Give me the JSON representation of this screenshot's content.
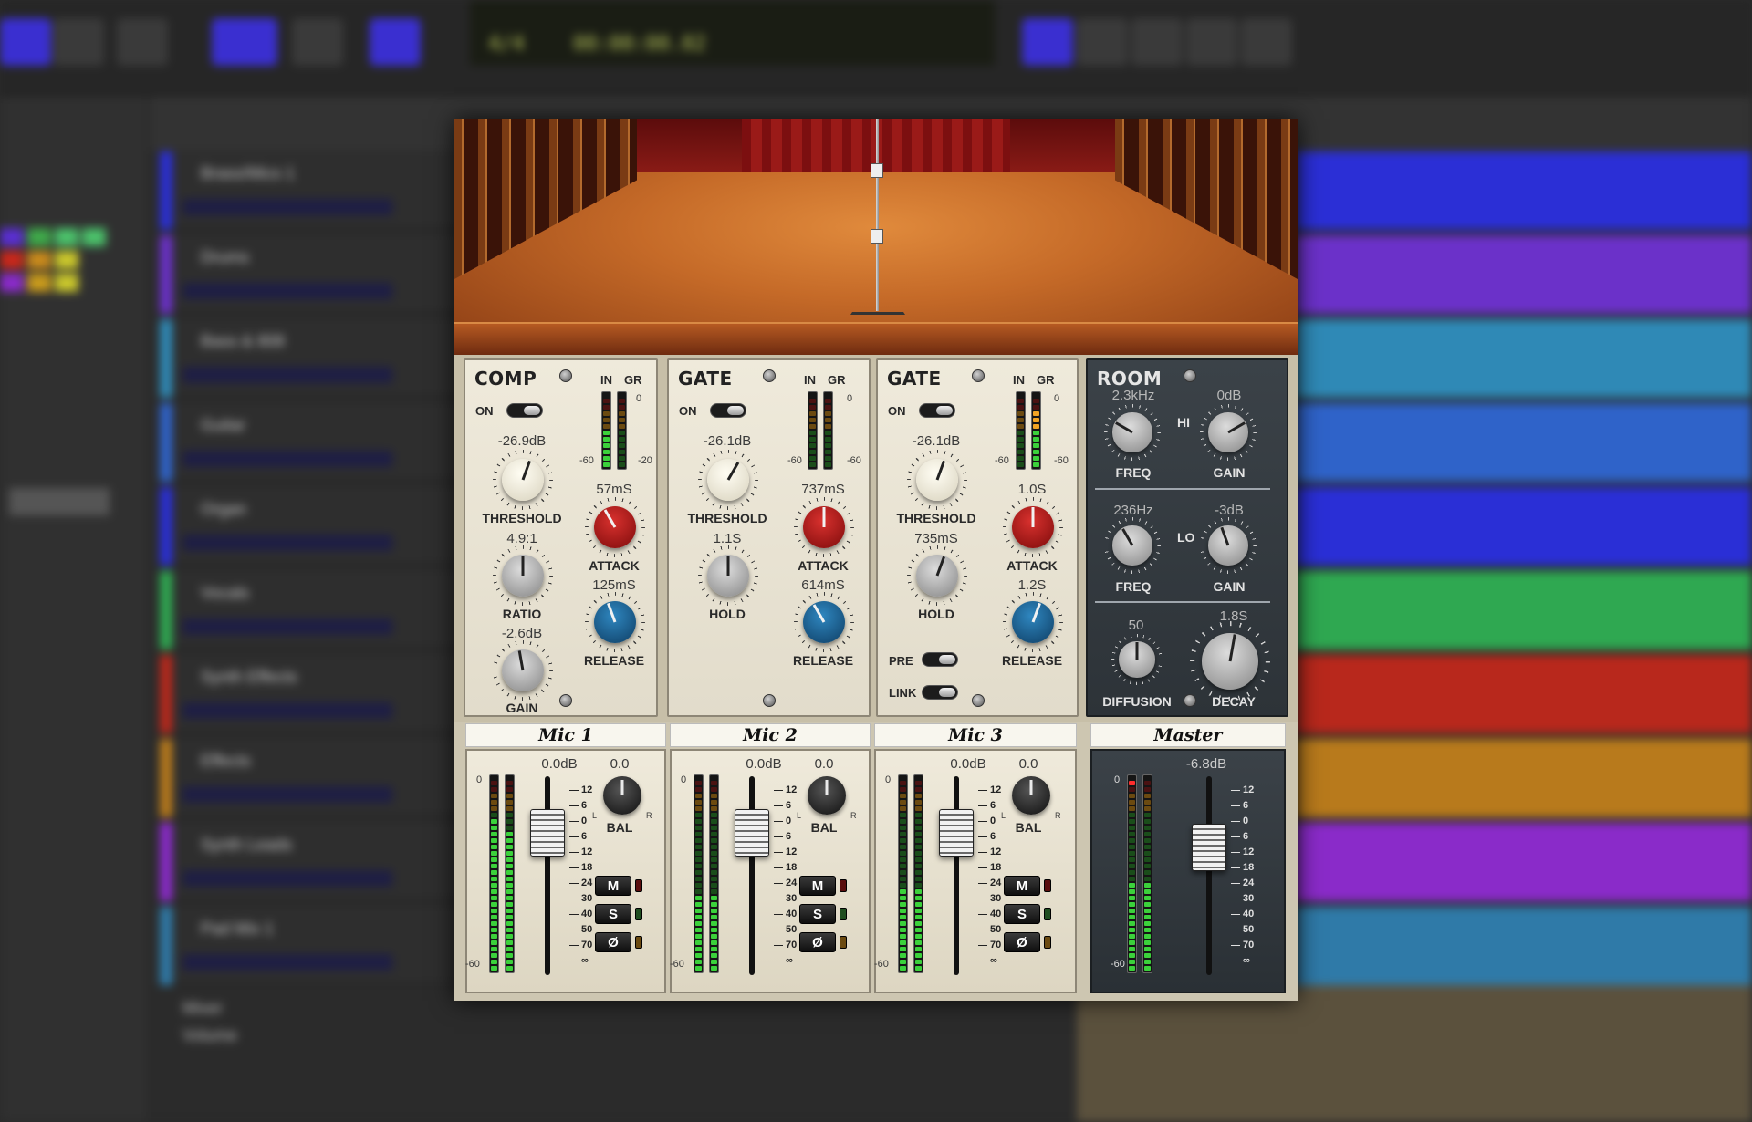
{
  "daw": {
    "lcd": [
      "4/4",
      "00:00:00.02"
    ],
    "tracks": [
      {
        "name": "Brass/Mics 1",
        "color": "#2b2fd6"
      },
      {
        "name": "Drums",
        "color": "#6b31c9"
      },
      {
        "name": "Bass & 808",
        "color": "#2f89b6"
      },
      {
        "name": "Guitar",
        "color": "#2f63c9"
      },
      {
        "name": "Organ",
        "color": "#2a2fd6"
      },
      {
        "name": "Vocals",
        "color": "#2fa851"
      },
      {
        "name": "Synth Effects",
        "color": "#b8281c"
      },
      {
        "name": "Effects",
        "color": "#b87a1c"
      },
      {
        "name": "Synth Leads",
        "color": "#8a2bc9"
      },
      {
        "name": "Pad Mix 1",
        "color": "#2f7aa8"
      }
    ],
    "bottom": {
      "label1": "Mixer",
      "label2": "Volume"
    }
  },
  "plugin": {
    "comp": {
      "title": "COMP",
      "on": "ON",
      "in": "IN",
      "gr": "GR",
      "meter_in": [
        "0",
        "-60"
      ],
      "meter_gr": [
        "0",
        "-20"
      ],
      "threshold": {
        "value": "-26.9dB",
        "label": "THRESHOLD"
      },
      "ratio": {
        "value": "4.9:1",
        "label": "RATIO"
      },
      "gain": {
        "value": "-2.6dB",
        "label": "GAIN"
      },
      "attack": {
        "value": "57mS",
        "label": "ATTACK"
      },
      "release": {
        "value": "125mS",
        "label": "RELEASE"
      }
    },
    "gate1": {
      "title": "GATE",
      "on": "ON",
      "in": "IN",
      "gr": "GR",
      "meter_in": [
        "0",
        "-60"
      ],
      "meter_gr": [
        "0",
        "-60"
      ],
      "threshold": {
        "value": "-26.1dB",
        "label": "THRESHOLD"
      },
      "hold": {
        "value": "1.1S",
        "label": "HOLD"
      },
      "attack": {
        "value": "737mS",
        "label": "ATTACK"
      },
      "release": {
        "value": "614mS",
        "label": "RELEASE"
      }
    },
    "gate2": {
      "title": "GATE",
      "on": "ON",
      "in": "IN",
      "gr": "GR",
      "meter_in": [
        "0",
        "-60"
      ],
      "meter_gr": [
        "0",
        "-60"
      ],
      "threshold": {
        "value": "-26.1dB",
        "label": "THRESHOLD"
      },
      "hold": {
        "value": "735mS",
        "label": "HOLD"
      },
      "attack": {
        "value": "1.0S",
        "label": "ATTACK"
      },
      "release": {
        "value": "1.2S",
        "label": "RELEASE"
      },
      "pre": "PRE",
      "link": "LINK"
    },
    "room": {
      "title": "ROOM",
      "hi": "HI",
      "lo": "LO",
      "hi_freq": {
        "value": "2.3kHz",
        "label": "FREQ"
      },
      "hi_gain": {
        "value": "0dB",
        "label": "GAIN"
      },
      "lo_freq": {
        "value": "236Hz",
        "label": "FREQ"
      },
      "lo_gain": {
        "value": "-3dB",
        "label": "GAIN"
      },
      "diffusion": {
        "value": "50",
        "label": "DIFFUSION"
      },
      "decay": {
        "value": "1.8S",
        "label": "DECAY"
      }
    },
    "channels": [
      {
        "name": "Mic 1",
        "fader": "0.0dB",
        "bal": "0.0",
        "bal_label": "BAL",
        "bal_l": "L",
        "bal_r": "R",
        "mute": "M",
        "solo": "S",
        "phase": "Ø",
        "meter_top": "0",
        "meter_bottom": "-60"
      },
      {
        "name": "Mic 2",
        "fader": "0.0dB",
        "bal": "0.0",
        "bal_label": "BAL",
        "bal_l": "L",
        "bal_r": "R",
        "mute": "M",
        "solo": "S",
        "phase": "Ø",
        "meter_top": "0",
        "meter_bottom": "-60"
      },
      {
        "name": "Mic 3",
        "fader": "0.0dB",
        "bal": "0.0",
        "bal_label": "BAL",
        "bal_l": "L",
        "bal_r": "R",
        "mute": "M",
        "solo": "S",
        "phase": "Ø",
        "meter_top": "0",
        "meter_bottom": "-60"
      }
    ],
    "master": {
      "name": "Master",
      "fader": "-6.8dB",
      "meter_top": "0",
      "meter_bottom": "-60"
    },
    "fader_scale": [
      "12",
      "6",
      "0",
      "6",
      "12",
      "18",
      "24",
      "30",
      "40",
      "50",
      "70",
      "∞"
    ],
    "colors": {
      "knob_red": "#b8141a",
      "knob_blue": "#1d6fa5",
      "panel_cream": "#ece6d5",
      "room_panel": "#343b40",
      "meter_green": "#3bd13b"
    }
  }
}
